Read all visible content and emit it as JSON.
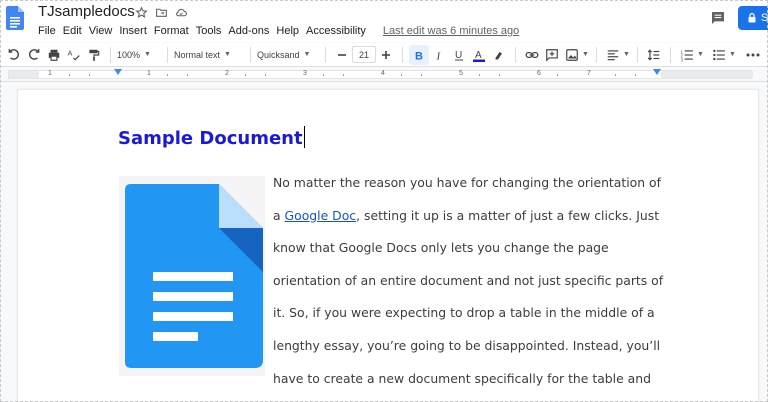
{
  "titlebar": {
    "doc_title": "TJsampledocs",
    "menu": [
      "File",
      "Edit",
      "View",
      "Insert",
      "Format",
      "Tools",
      "Add-ons",
      "Help",
      "Accessibility"
    ],
    "last_edit": "Last edit was 6 minutes ago",
    "share_label": "S"
  },
  "toolbar": {
    "zoom": "100%",
    "style": "Normal text",
    "font": "Quicksand",
    "font_size": "21",
    "text_color": "#1a1ad6"
  },
  "ruler": {
    "numbers": [
      "1",
      "1",
      "2",
      "3",
      "4",
      "5",
      "6",
      "7"
    ]
  },
  "document": {
    "heading": "Sample Document",
    "heading_color": "#1a1ad6",
    "link_color": "#1155cc",
    "lines": [
      {
        "before": "No matter the reason you have for changing the orientation of",
        "link": "",
        "after": ""
      },
      {
        "before": "a ",
        "link": "Google Doc",
        "after": ", setting it up is a matter of just a few clicks. Just"
      },
      {
        "before": "know that Google Docs only lets you change the page",
        "link": "",
        "after": ""
      },
      {
        "before": "orientation of an entire document and not just specific parts of",
        "link": "",
        "after": ""
      },
      {
        "before": "it. So, if you were expecting to drop a table in the middle of a",
        "link": "",
        "after": ""
      },
      {
        "before": "lengthy essay, you’re going to be disappointed. Instead, you’ll",
        "link": "",
        "after": ""
      },
      {
        "before": "have to create a new document specifically for the table and",
        "link": "",
        "after": ""
      }
    ]
  }
}
